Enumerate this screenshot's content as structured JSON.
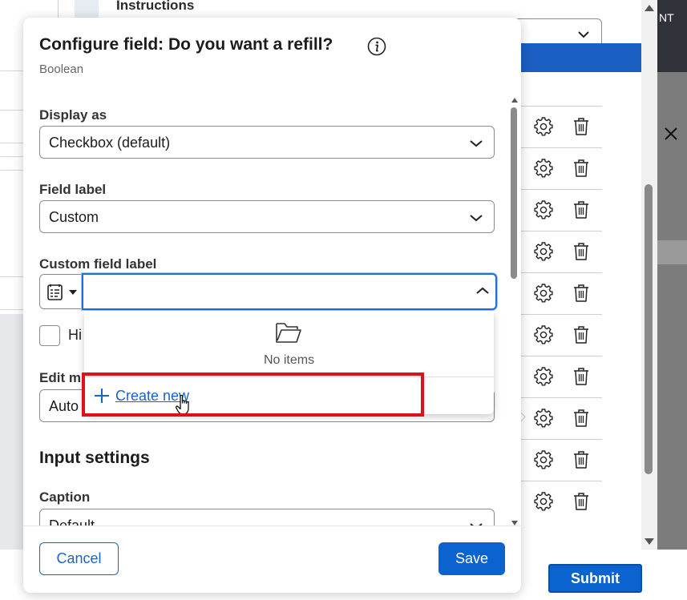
{
  "background": {
    "section_title": "Instructions",
    "top_right_label": "NT",
    "submit_label": "Submit",
    "row_count": 10
  },
  "modal": {
    "title": "Configure field: Do you want a refill?",
    "subtitle": "Boolean",
    "fields": {
      "display_as": {
        "label": "Display as",
        "value": "Checkbox (default)"
      },
      "field_label": {
        "label": "Field label",
        "value": "Custom"
      },
      "custom_field_label": {
        "label": "Custom field label",
        "value": ""
      },
      "hide_checkbox": {
        "label": "Hi"
      },
      "edit_mode": {
        "label": "Edit m",
        "value": "Auto"
      }
    },
    "input_settings": {
      "title": "Input settings",
      "caption": {
        "label": "Caption",
        "value": "Default"
      }
    },
    "dropdown": {
      "empty_text": "No items",
      "create_new_label": "Create new"
    },
    "footer": {
      "cancel_label": "Cancel",
      "save_label": "Save"
    }
  },
  "colors": {
    "primary": "#0b63cf",
    "link": "#1a64c9",
    "highlight": "#e0101b",
    "focus": "#1e6fd9"
  },
  "icons": [
    "info-icon",
    "chevron-down-icon",
    "chevron-up-icon",
    "property-picker-icon",
    "folder-icon",
    "plus-icon",
    "hand-cursor-icon",
    "gear-icon",
    "trash-icon",
    "close-icon"
  ]
}
